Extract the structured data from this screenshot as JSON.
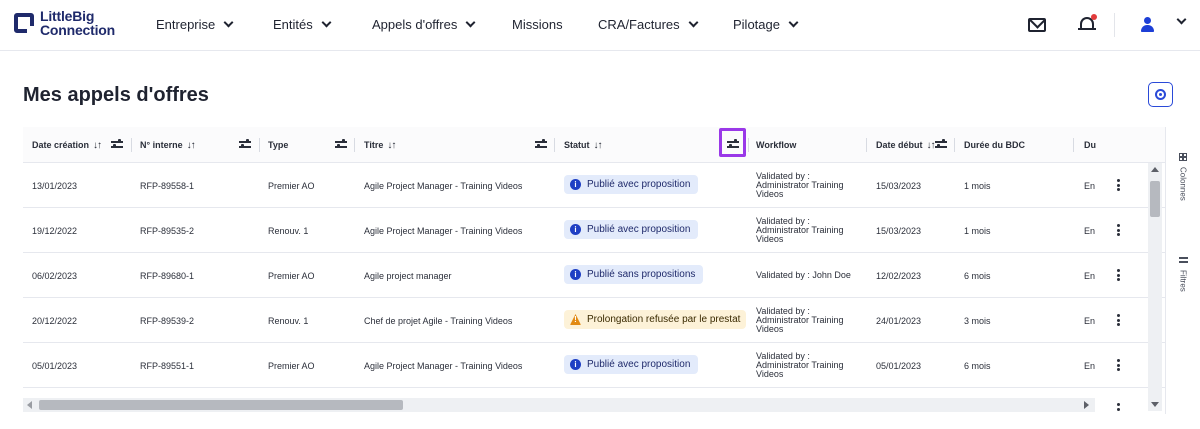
{
  "brand": {
    "line1": "LittleBig",
    "line2": "Connection"
  },
  "nav": [
    {
      "label": "Entreprise",
      "has_menu": true
    },
    {
      "label": "Entités",
      "has_menu": true
    },
    {
      "label": "Appels d'offres",
      "has_menu": true
    },
    {
      "label": "Missions",
      "has_menu": false
    },
    {
      "label": "CRA/Factures",
      "has_menu": true
    },
    {
      "label": "Pilotage",
      "has_menu": true
    }
  ],
  "header_icons": [
    "mail-icon",
    "bell-icon",
    "user-icon"
  ],
  "page": {
    "title": "Mes appels d'offres"
  },
  "table": {
    "columns": [
      {
        "label": "Date création",
        "sortable": true,
        "filterable": true
      },
      {
        "label": "N° interne",
        "sortable": true,
        "filterable": true
      },
      {
        "label": "Type",
        "sortable": false,
        "filterable": true
      },
      {
        "label": "Titre",
        "sortable": true,
        "filterable": true
      },
      {
        "label": "Statut",
        "sortable": true,
        "filterable": true
      },
      {
        "label": "Workflow",
        "sortable": false,
        "filterable": false
      },
      {
        "label": "Date début",
        "sortable": true,
        "filterable": true
      },
      {
        "label": "Durée du BDC",
        "sortable": false,
        "filterable": false
      },
      {
        "label": "Du",
        "sortable": false,
        "filterable": false
      }
    ],
    "rows": [
      {
        "date_creation": "13/01/2023",
        "num_interne": "RFP-89558-1",
        "type": "Premier AO",
        "titre": "Agile Project Manager - Training Videos",
        "statut": "Publié avec proposition",
        "statut_kind": "info",
        "workflow": "Validated by : Administrator Training Videos",
        "date_debut": "15/03/2023",
        "duree": "1 mois",
        "du": "En"
      },
      {
        "date_creation": "19/12/2022",
        "num_interne": "RFP-89535-2",
        "type": "Renouv. 1",
        "titre": "Agile Project Manager - Training Videos",
        "statut": "Publié avec proposition",
        "statut_kind": "info",
        "workflow": "Validated by : Administrator Training Videos",
        "date_debut": "15/03/2023",
        "duree": "1 mois",
        "du": "En"
      },
      {
        "date_creation": "06/02/2023",
        "num_interne": "RFP-89680-1",
        "type": "Premier AO",
        "titre": "Agile project manager",
        "statut": "Publié sans propositions",
        "statut_kind": "info",
        "workflow": "Validated by : John Doe",
        "date_debut": "12/02/2023",
        "duree": "6 mois",
        "du": "En"
      },
      {
        "date_creation": "20/12/2022",
        "num_interne": "RFP-89539-2",
        "type": "Renouv. 1",
        "titre": "Chef de projet Agile - Training Videos",
        "statut": "Prolongation refusée par le prestat",
        "statut_kind": "warn",
        "workflow": "Validated by : Administrator Training Videos",
        "date_debut": "24/01/2023",
        "duree": "3 mois",
        "du": "En"
      },
      {
        "date_creation": "05/01/2023",
        "num_interne": "RFP-89551-1",
        "type": "Premier AO",
        "titre": "Agile Project Manager - Training Videos",
        "statut": "Publié avec proposition",
        "statut_kind": "info",
        "workflow": "Validated by : Administrator Training Videos",
        "date_debut": "05/01/2023",
        "duree": "6 mois",
        "du": "En"
      }
    ]
  },
  "side_panel": {
    "columns_label": "Colonnes",
    "filters_label": "Filtres"
  },
  "colors": {
    "brand": "#1f2a6b",
    "accent": "#2a4ad8",
    "highlight": "#9a38e8",
    "info_badge": "#e3ebfb",
    "warn_badge": "#fdf2d8"
  }
}
